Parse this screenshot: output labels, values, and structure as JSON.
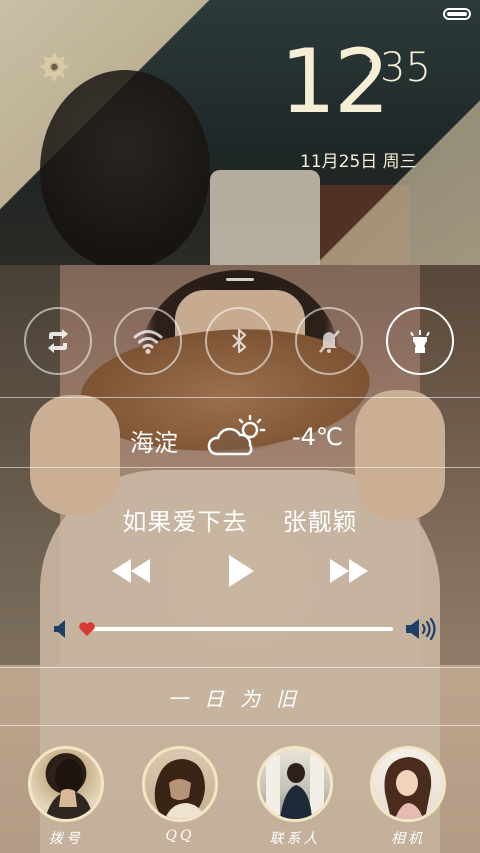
{
  "status_bar": {
    "battery_icon": "battery-full-icon",
    "battery_level": 1.0
  },
  "settings": {
    "icon": "gear-icon"
  },
  "clock": {
    "hours": "12",
    "separator": ":",
    "minutes": "35",
    "date": "11月25日 周三"
  },
  "quick_toggles": [
    {
      "name": "sync",
      "icon": "sync-icon",
      "active": false
    },
    {
      "name": "wifi",
      "icon": "wifi-icon",
      "active": false
    },
    {
      "name": "bluetooth",
      "icon": "bluetooth-icon",
      "active": false
    },
    {
      "name": "sound",
      "icon": "mute-icon",
      "active": false
    },
    {
      "name": "flashlight",
      "icon": "flashlight-icon",
      "active": true
    }
  ],
  "weather": {
    "city": "海淀",
    "icon": "partly-cloudy-icon",
    "temperature": "-4℃"
  },
  "music": {
    "title": "如果爱下去",
    "artist": "张靓颖",
    "previous_icon": "rewind-icon",
    "play_icon": "play-icon",
    "next_icon": "fast-forward-icon",
    "volume_low_icon": "volume-low-icon",
    "volume_high_icon": "volume-high-icon",
    "volume_level": 0.0,
    "thumb_icon": "heart-icon"
  },
  "motto": "一日为旧",
  "shortcuts": [
    {
      "label": "拨号",
      "icon": "dialer-avatar"
    },
    {
      "label": "QQ",
      "icon": "qq-avatar"
    },
    {
      "label": "联系人",
      "icon": "contacts-avatar"
    },
    {
      "label": "相机",
      "icon": "camera-avatar"
    }
  ],
  "colors": {
    "clock": "#f6efd6",
    "avatar_border": "#f3e6c4",
    "thumb": "#d63a32",
    "volume_icon": "#1f3f66"
  }
}
